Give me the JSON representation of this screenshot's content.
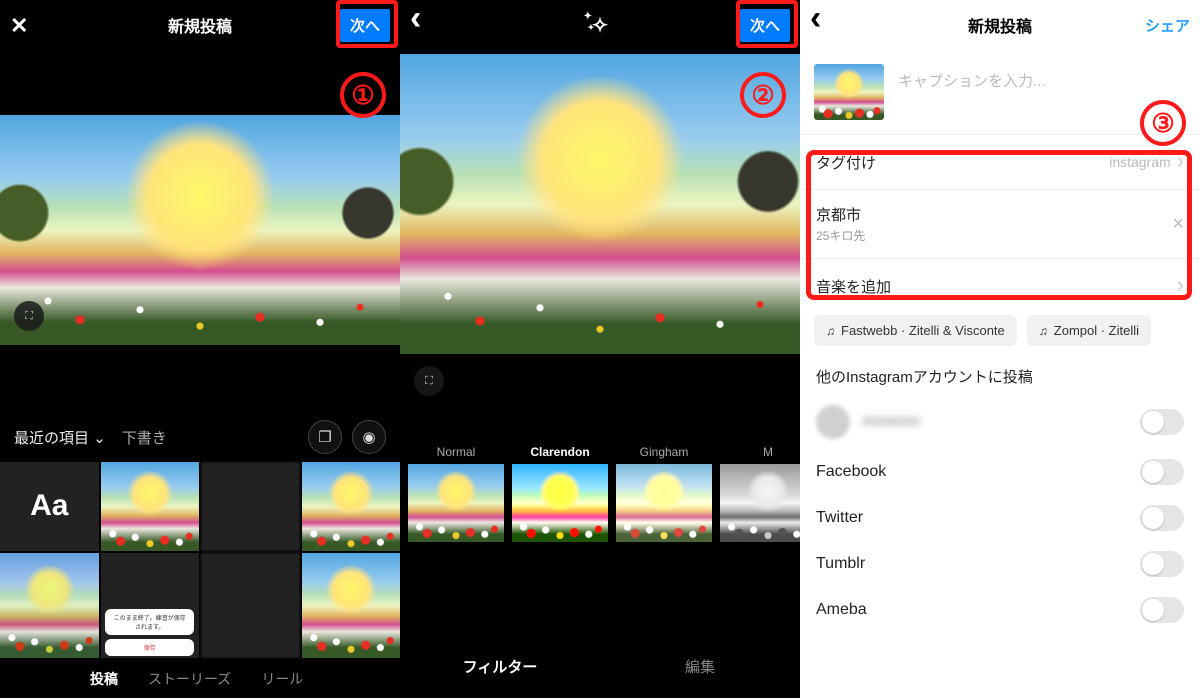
{
  "screen1": {
    "title": "新規投稿",
    "next": "次へ",
    "recent": "最近の項目",
    "drafts": "下書き",
    "tabs": {
      "post": "投稿",
      "stories": "ストーリーズ",
      "reel": "リール"
    }
  },
  "screen2": {
    "next": "次へ",
    "filters": {
      "normal": "Normal",
      "clarendon": "Clarendon",
      "gingham": "Gingham",
      "more": "M"
    },
    "tabs": {
      "filter": "フィルター",
      "edit": "編集"
    }
  },
  "screen3": {
    "title": "新規投稿",
    "share": "シェア",
    "caption_placeholder": "キャプションを入力...",
    "rows": {
      "tag": {
        "label": "タグ付け",
        "value": "instagram"
      },
      "location": {
        "label": "京都市",
        "sub": "25キロ先"
      },
      "music": {
        "label": "音楽を追加"
      }
    },
    "music_chips": {
      "a": "Fastwebb · Zitelli & Visconte",
      "b": "Zompol · Zitelli"
    },
    "share_section": "他のInstagramアカウントに投稿",
    "targets": {
      "fb": "Facebook",
      "tw": "Twitter",
      "tb": "Tumblr",
      "am": "Ameba"
    }
  },
  "annotations": {
    "b1": "①",
    "b2": "②",
    "b3": "③"
  }
}
